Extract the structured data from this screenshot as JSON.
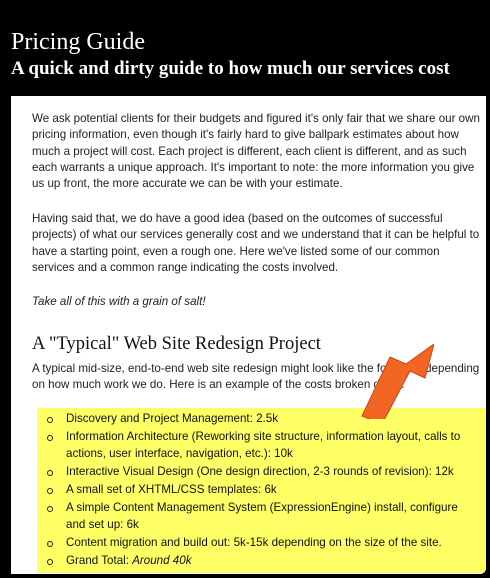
{
  "header": {
    "title": "Pricing Guide",
    "subtitle": "A quick and dirty guide to how much our services cost"
  },
  "content": {
    "paragraph_1": "We ask potential clients for their budgets and figured it's only fair that we share our own pricing information, even though it's fairly hard to give ballpark estimates about how much a project will cost. Each project is different, each client is different, and as such each warrants a unique approach. It's important to note: the more information you give us up front, the more accurate we can be with your estimate.",
    "paragraph_2": "Having said that, we do have a good idea (based on the outcomes of successful projects) of what our services generally cost and we understand that it can be helpful to have a starting point, even a rough one. Here we've listed some of our common services and a common range indicating the costs involved.",
    "paragraph_3": "Take all of this with a grain of salt!",
    "section_heading": "A \"Typical\" Web Site Redesign Project",
    "section_intro": "A typical mid-size, end-to-end web site redesign might look like the following depending on how much work we do. Here is an example of the costs broken down:",
    "cost_items": [
      "Discovery and Project Management: 2.5k",
      "Information Architecture (Reworking site structure, information layout, calls to actions, user interface, navigation, etc.): 10k",
      "Interactive Visual Design (One design direction, 2-3 rounds of revision): 12k",
      "A small set of XHTML/CSS templates: 6k",
      "A simple Content Management System (ExpressionEngine) install, configure and set up: 6k",
      "Content migration and build out: 5k-15k depending on the size of the site."
    ],
    "grand_total_label": "Grand Total:",
    "grand_total_value": "Around 40k"
  },
  "colors": {
    "header_background": "#000000",
    "highlight": "#ffff66",
    "arrow": "#f26522"
  },
  "icons": {
    "annotation": "orange-arrow-icon"
  }
}
